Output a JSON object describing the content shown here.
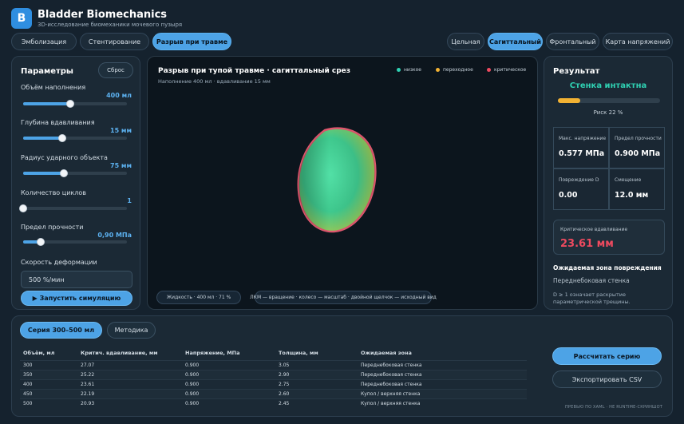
{
  "header": {
    "logo_letter": "B",
    "title": "Bladder Biomechanics",
    "subtitle": "3D-исследование биомеханики мочевого пузыря"
  },
  "modes": [
    {
      "label": "Эмболизация",
      "active": false
    },
    {
      "label": "Стентирование",
      "active": false
    },
    {
      "label": "Разрыв при травме",
      "active": true
    }
  ],
  "views": [
    {
      "label": "Цельная",
      "active": false
    },
    {
      "label": "Сагиттальный",
      "active": true
    },
    {
      "label": "Фронтальный",
      "active": false
    },
    {
      "label": "Карта напряжений",
      "active": false
    }
  ],
  "params": {
    "title": "Параметры",
    "reset_label": "Сброс",
    "items": [
      {
        "label": "Объём наполнения",
        "value": "400 мл",
        "fill": 0.45
      },
      {
        "label": "Глубина вдавливания",
        "value": "15 мм",
        "fill": 0.38
      },
      {
        "label": "Радиус ударного объекта",
        "value": "75 мм",
        "fill": 0.39
      },
      {
        "label": "Количество циклов",
        "value": "1",
        "fill": 0.0
      },
      {
        "label": "Предел прочности",
        "value": "0,90 МПа",
        "fill": 0.17
      }
    ],
    "rate_label": "Скорость деформации",
    "rate_value": "500 %/мин",
    "run_label": "▶ Запустить симуляцию"
  },
  "viewport": {
    "title": "Разрыв при тупой травме · сагиттальный срез",
    "subtitle": "Наполнение 400 мл · вдавливание 15 мм",
    "legend": [
      {
        "label": "низкое",
        "color": "#2fd1b3"
      },
      {
        "label": "переходное",
        "color": "#f2b233"
      },
      {
        "label": "критическое",
        "color": "#ee4a5f"
      }
    ],
    "fluid_chip": "Жидкость · 400 мл · 71 %",
    "hint_chip": "ЛКМ — вращение · колесо — масштаб · двойной щелчок — исходный вид"
  },
  "result": {
    "title": "Результат",
    "status": "Стенка интактна",
    "risk_fraction": 0.22,
    "risk_label": "Риск 22 %",
    "metrics": [
      {
        "label": "Макс. напряжение",
        "value": "0.577 МПа"
      },
      {
        "label": "Предел прочности",
        "value": "0.900 МПа"
      },
      {
        "label": "Повреждение D",
        "value": "0.00"
      },
      {
        "label": "Смещение",
        "value": "12.0 мм"
      }
    ],
    "crit_label": "Критическое вдавливание",
    "crit_value": "23.61 мм",
    "zone_title": "Ожидаемая зона повреждения",
    "zone_value": "Переднебоковая стенка",
    "zone_note": "D ≥ 1 означает раскрытие параметрической трещины."
  },
  "series": {
    "tabs": [
      {
        "label": "Серия 300–500 мл",
        "active": true
      },
      {
        "label": "Методика",
        "active": false
      }
    ],
    "columns": [
      "Объём, мл",
      "Критич. вдавливание, мм",
      "Напряжение, МПа",
      "Толщина, мм",
      "Ожидаемая зона"
    ],
    "rows": [
      [
        "300",
        "27.07",
        "0.900",
        "3.05",
        "Переднебоковая стенка"
      ],
      [
        "350",
        "25.22",
        "0.900",
        "2.90",
        "Переднебоковая стенка"
      ],
      [
        "400",
        "23.61",
        "0.900",
        "2.75",
        "Переднебоковая стенка"
      ],
      [
        "450",
        "22.19",
        "0.900",
        "2.60",
        "Купол / верхняя стенка"
      ],
      [
        "500",
        "20.93",
        "0.900",
        "2.45",
        "Купол / верхняя стенка"
      ]
    ],
    "calc_label": "Рассчитать серию",
    "export_label": "Экспортировать CSV",
    "footnote": "ПРЕВЬЮ ПО XAML · НЕ RUNTIME-СКРИНШОТ"
  }
}
